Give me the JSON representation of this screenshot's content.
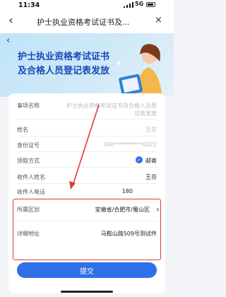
{
  "status_bar": {
    "time": "11:34",
    "network": "5G"
  },
  "nav": {
    "back_icon": "‹",
    "title": "护士执业资格考试证书及...",
    "close_icon": "×"
  },
  "hero": {
    "back_icon": "‹",
    "title_line1": "护士执业资格考试证书",
    "title_line2": "及合格人员登记表发放"
  },
  "form": {
    "item_name": {
      "label": "事项名称",
      "value": "护士执业资格考试证书及合格人员登记表发放"
    },
    "name": {
      "label": "姓名",
      "value": "王芬"
    },
    "id_number": {
      "label": "身份证号",
      "value": "340**********0022"
    },
    "collect_method": {
      "label": "领取方式",
      "value": "邮寄",
      "checked": true
    },
    "recipient_name": {
      "label": "收件人姓名",
      "value": "王芬"
    },
    "recipient_phone": {
      "label": "收件人电话",
      "value": "180"
    },
    "region": {
      "label": "所属区划",
      "value": "安徽省/合肥市/蜀山区"
    },
    "address": {
      "label": "详细地址",
      "value": "马鞍山路509号测试件"
    }
  },
  "submit_label": "提交",
  "colors": {
    "accent": "#2f6fe8",
    "highlight": "#e23a3a",
    "hero_title": "#1c48b8"
  }
}
